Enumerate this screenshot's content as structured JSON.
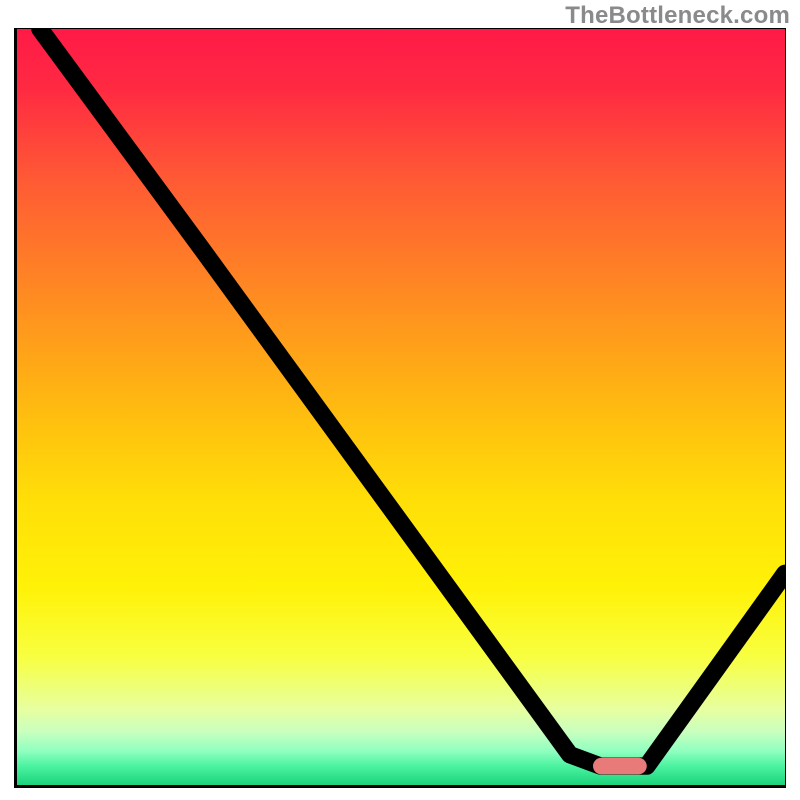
{
  "watermark": "TheBottleneck.com",
  "chart_data": {
    "type": "line",
    "title": "",
    "xlabel": "",
    "ylabel": "",
    "xlim": [
      0,
      100
    ],
    "ylim": [
      0,
      100
    ],
    "curve": [
      {
        "x": 3,
        "y": 100
      },
      {
        "x": 24,
        "y": 71
      },
      {
        "x": 72,
        "y": 4
      },
      {
        "x": 76,
        "y": 2.5
      },
      {
        "x": 82,
        "y": 2.5
      },
      {
        "x": 100,
        "y": 28
      }
    ],
    "marker": {
      "x_start": 75,
      "x_end": 82,
      "y": 2.5,
      "height": 2.2,
      "color": "#e97a7a"
    },
    "gradient_stops": [
      {
        "offset": 0.0,
        "color": "#ff1a47"
      },
      {
        "offset": 0.08,
        "color": "#ff2a42"
      },
      {
        "offset": 0.2,
        "color": "#ff5a34"
      },
      {
        "offset": 0.35,
        "color": "#ff8a22"
      },
      {
        "offset": 0.5,
        "color": "#ffba10"
      },
      {
        "offset": 0.62,
        "color": "#ffde08"
      },
      {
        "offset": 0.74,
        "color": "#fff208"
      },
      {
        "offset": 0.83,
        "color": "#f8ff40"
      },
      {
        "offset": 0.9,
        "color": "#e7ffa0"
      },
      {
        "offset": 0.93,
        "color": "#c8ffbf"
      },
      {
        "offset": 0.955,
        "color": "#90ffc0"
      },
      {
        "offset": 0.975,
        "color": "#4cf3a0"
      },
      {
        "offset": 1.0,
        "color": "#1ad37a"
      }
    ]
  }
}
